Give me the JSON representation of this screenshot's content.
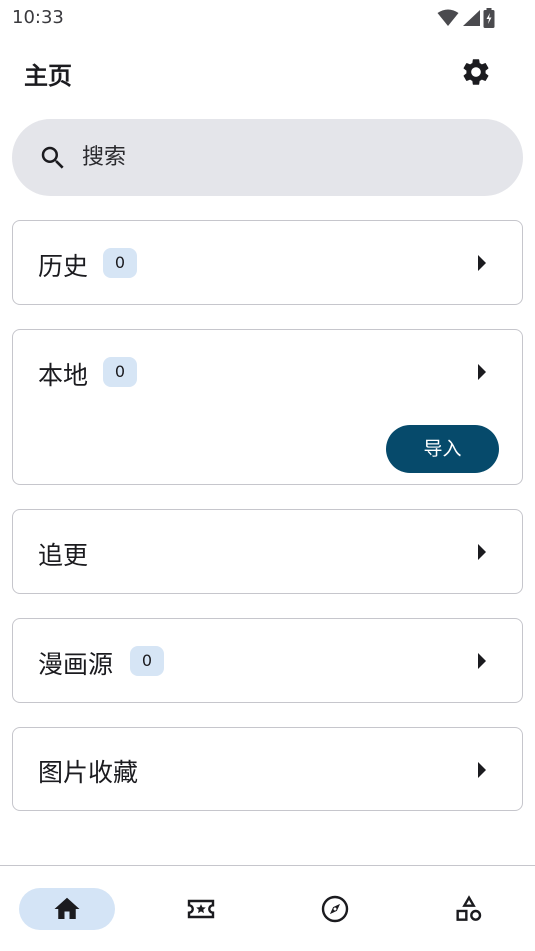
{
  "status_bar": {
    "time": "10:33",
    "icons": [
      "wifi-icon",
      "cellular-signal-icon",
      "battery-charging-icon"
    ]
  },
  "header": {
    "title": "主页",
    "settings_icon": "gear-icon"
  },
  "search": {
    "placeholder": "搜索",
    "value": ""
  },
  "sections": {
    "history": {
      "label": "历史",
      "count": "0"
    },
    "local": {
      "label": "本地",
      "count": "0",
      "import_label": "导入"
    },
    "follow": {
      "label": "追更"
    },
    "sources": {
      "label": "漫画源",
      "count": "0"
    },
    "favorites": {
      "label": "图片收藏"
    }
  },
  "bottom_nav": {
    "items": [
      {
        "icon": "home-icon",
        "active": true
      },
      {
        "icon": "star-ticket-icon",
        "active": false
      },
      {
        "icon": "compass-icon",
        "active": false
      },
      {
        "icon": "categories-icon",
        "active": false
      }
    ]
  },
  "colors": {
    "accent": "#064a6b",
    "badge": "#d6e5f5",
    "search_bg": "#e4e5ea",
    "nav_active": "#d4e4f6"
  }
}
